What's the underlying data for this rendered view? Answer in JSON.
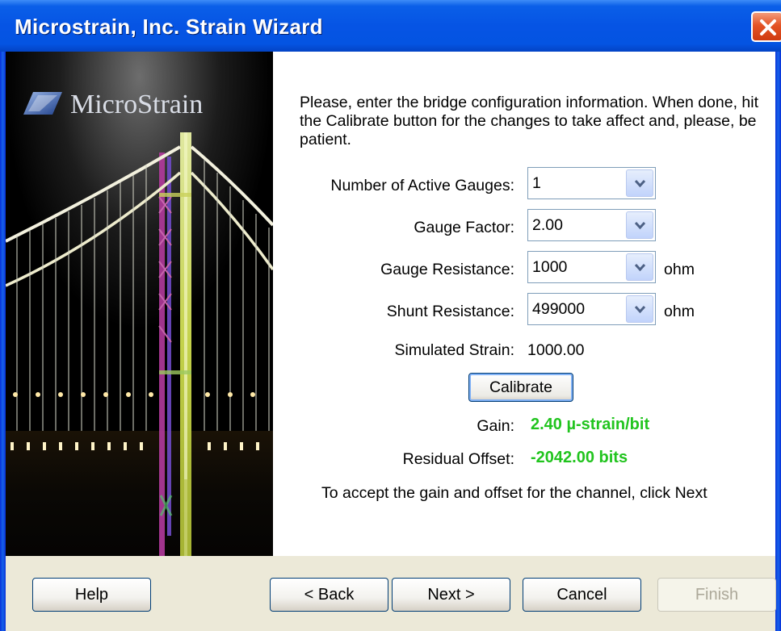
{
  "window": {
    "title": "Microstrain, Inc. Strain Wizard"
  },
  "hero": {
    "brand_text": "MicroStrain"
  },
  "content": {
    "instructions": "Please, enter the bridge configuration information.  When done, hit the Calibrate button for the changes to take affect and, please, be patient.",
    "fields": {
      "active_gauges": {
        "label": "Number of Active Gauges:",
        "value": "1"
      },
      "gauge_factor": {
        "label": "Gauge Factor:",
        "value": "2.00"
      },
      "gauge_resistance": {
        "label": "Gauge Resistance:",
        "value": "1000",
        "unit": "ohm"
      },
      "shunt_resistance": {
        "label": "Shunt Resistance:",
        "value": "499000",
        "unit": "ohm"
      },
      "simulated_strain": {
        "label": "Simulated Strain:",
        "value": "1000.00"
      }
    },
    "calibrate_label": "Calibrate",
    "results": {
      "gain": {
        "label": "Gain:",
        "value": "2.40 µ-strain/bit"
      },
      "residual_offset": {
        "label": "Residual Offset:",
        "value": "-2042.00 bits"
      }
    },
    "footer_note": "To accept the gain and offset for the channel, click Next"
  },
  "buttons": {
    "help": "Help",
    "back": "< Back",
    "next": "Next >",
    "cancel": "Cancel",
    "finish": "Finish"
  },
  "colors": {
    "title_bar": "#0454e2",
    "result_text": "#21c41e",
    "dialog_background": "#ece9d8"
  },
  "icons": {
    "close": "close-icon",
    "dropdown": "chevron-down-icon",
    "logo": "microstrain-logo-icon"
  }
}
